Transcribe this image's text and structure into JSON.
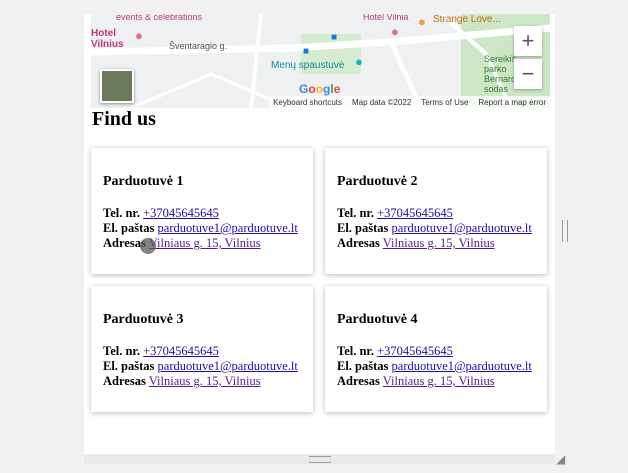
{
  "map": {
    "labels": {
      "events": "events & celebrations",
      "hotel_left": "Hotel\nVilnius",
      "hotel_right": "Hotel Vilnia",
      "strange_love": "Strange Love...",
      "street": "Šventaragio g.",
      "menu_spaustuve": "Menų spaustuvė",
      "sereikis": "Sereikiš parko Bernard sodas"
    },
    "google": "Google",
    "footer": {
      "shortcuts": "Keyboard shortcuts",
      "map_data": "Map data ©2022",
      "terms": "Terms of Use",
      "report": "Report a map error"
    },
    "zoom_in": "+",
    "zoom_out": "−"
  },
  "heading": "Find us",
  "stores": [
    {
      "name": "Parduotuvė 1",
      "tel_label": "Tel. nr.",
      "tel": "+37045645645",
      "email_label": "El. paštas",
      "email": "parduotuve1@parduotuve.lt",
      "addr_label": "Adresas",
      "address": "Vilniaus g. 15, Vilnius"
    },
    {
      "name": "Parduotuvė 2",
      "tel_label": "Tel. nr.",
      "tel": "+37045645645",
      "email_label": "El. paštas",
      "email": "parduotuve1@parduotuve.lt",
      "addr_label": "Adresas",
      "address": "Vilniaus g. 15, Vilnius"
    },
    {
      "name": "Parduotuvė 3",
      "tel_label": "Tel. nr.",
      "tel": "+37045645645",
      "email_label": "El. paštas",
      "email": "parduotuve1@parduotuve.lt",
      "addr_label": "Adresas",
      "address": "Vilniaus g. 15, Vilnius"
    },
    {
      "name": "Parduotuvė 4",
      "tel_label": "Tel. nr.",
      "tel": "+37045645645",
      "email_label": "El. paštas",
      "email": "parduotuve1@parduotuve.lt",
      "addr_label": "Adresas",
      "address": "Vilniaus g. 15, Vilnius"
    }
  ]
}
